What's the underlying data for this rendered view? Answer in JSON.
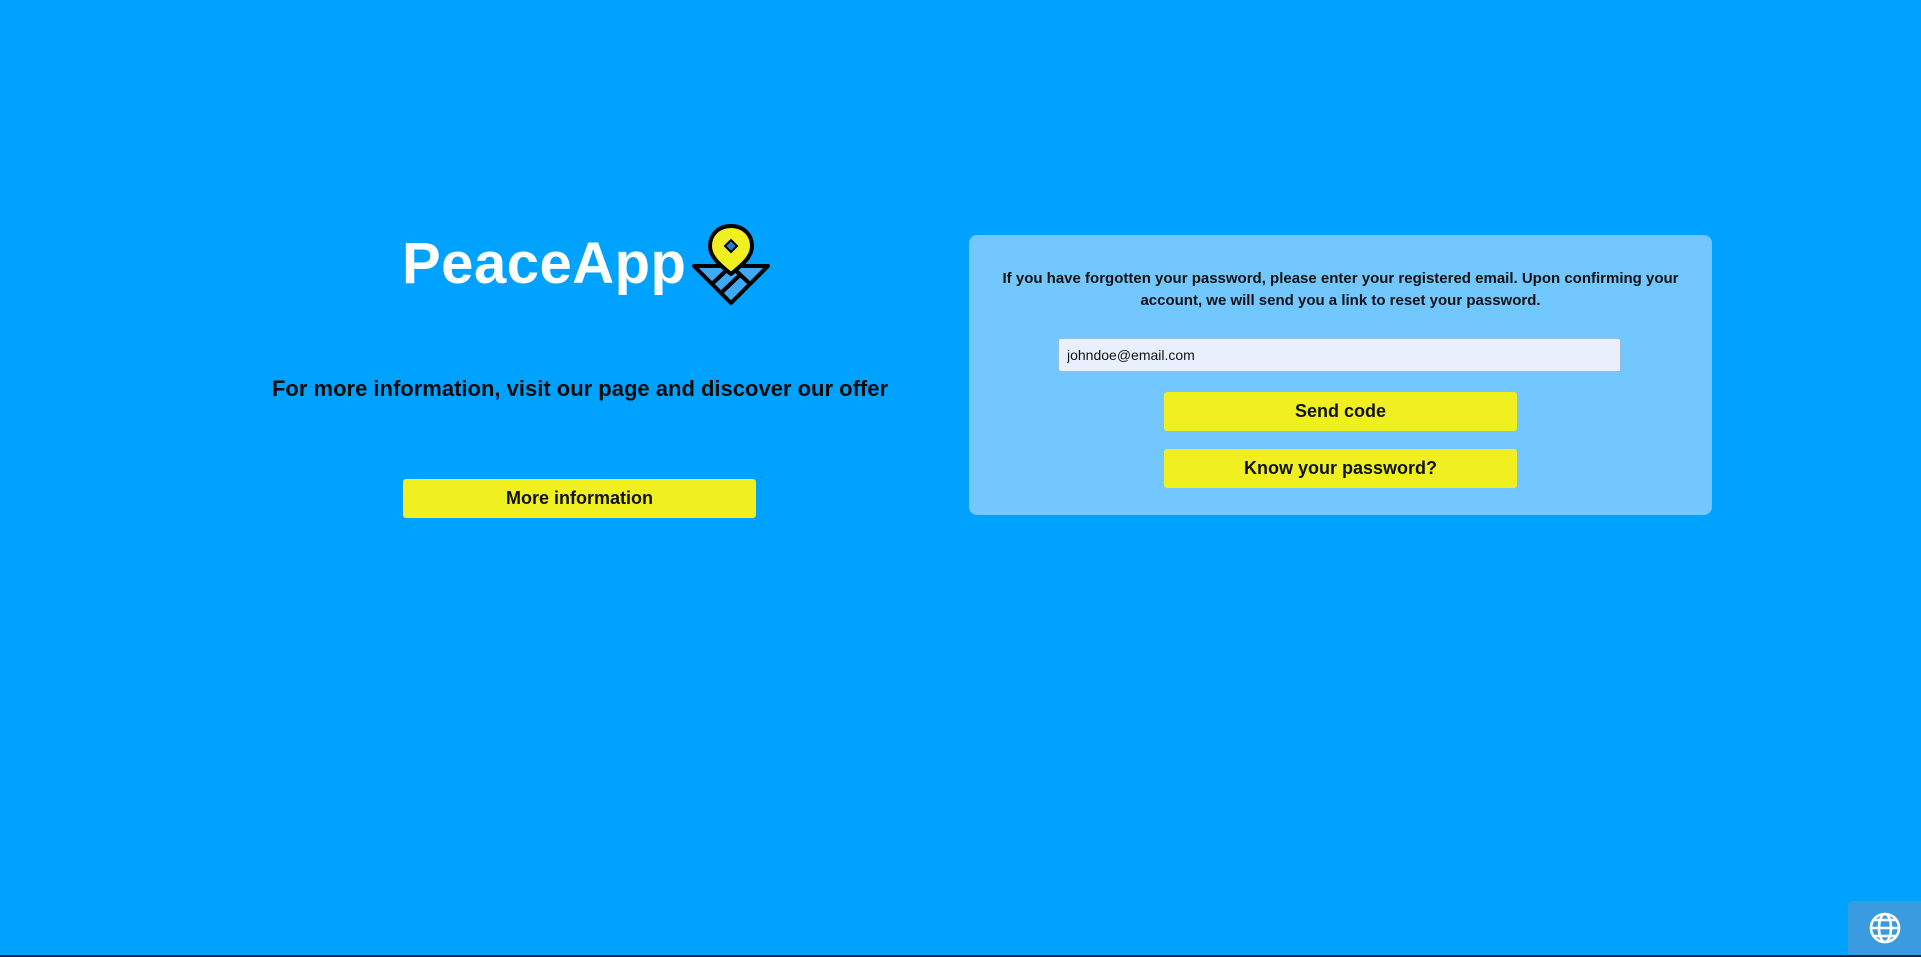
{
  "brand": {
    "name": "PeaceApp"
  },
  "info": {
    "tagline": "For more information, visit our page and discover our offer",
    "more_button": "More information"
  },
  "reset_panel": {
    "message": "If you have forgotten your password, please enter your registered email. Upon confirming your account, we will send you a link to reset your password.",
    "email_value": "johndoe@email.com",
    "send_button": "Send code",
    "know_password_button": "Know your password?"
  },
  "language_button": {
    "icon": "globe-icon"
  },
  "colors": {
    "background": "#00a2ff",
    "panel": "#72c7ff",
    "button": "#f0f020",
    "input": "#e8f0fe"
  }
}
